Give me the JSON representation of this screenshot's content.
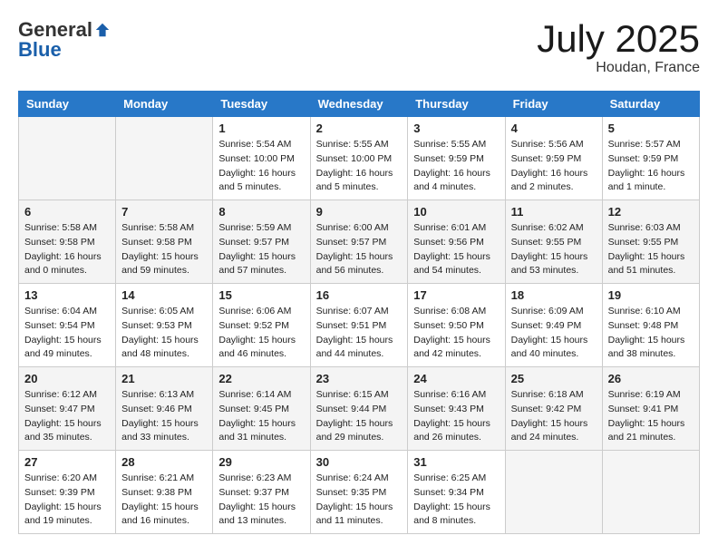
{
  "header": {
    "logo_general": "General",
    "logo_blue": "Blue",
    "month": "July 2025",
    "location": "Houdan, France"
  },
  "weekdays": [
    "Sunday",
    "Monday",
    "Tuesday",
    "Wednesday",
    "Thursday",
    "Friday",
    "Saturday"
  ],
  "weeks": [
    [
      {
        "day": "",
        "empty": true
      },
      {
        "day": "",
        "empty": true
      },
      {
        "day": "1",
        "sunrise": "5:54 AM",
        "sunset": "10:00 PM",
        "daylight": "16 hours and 5 minutes."
      },
      {
        "day": "2",
        "sunrise": "5:55 AM",
        "sunset": "10:00 PM",
        "daylight": "16 hours and 5 minutes."
      },
      {
        "day": "3",
        "sunrise": "5:55 AM",
        "sunset": "9:59 PM",
        "daylight": "16 hours and 4 minutes."
      },
      {
        "day": "4",
        "sunrise": "5:56 AM",
        "sunset": "9:59 PM",
        "daylight": "16 hours and 2 minutes."
      },
      {
        "day": "5",
        "sunrise": "5:57 AM",
        "sunset": "9:59 PM",
        "daylight": "16 hours and 1 minute."
      }
    ],
    [
      {
        "day": "6",
        "sunrise": "5:58 AM",
        "sunset": "9:58 PM",
        "daylight": "16 hours and 0 minutes."
      },
      {
        "day": "7",
        "sunrise": "5:58 AM",
        "sunset": "9:58 PM",
        "daylight": "15 hours and 59 minutes."
      },
      {
        "day": "8",
        "sunrise": "5:59 AM",
        "sunset": "9:57 PM",
        "daylight": "15 hours and 57 minutes."
      },
      {
        "day": "9",
        "sunrise": "6:00 AM",
        "sunset": "9:57 PM",
        "daylight": "15 hours and 56 minutes."
      },
      {
        "day": "10",
        "sunrise": "6:01 AM",
        "sunset": "9:56 PM",
        "daylight": "15 hours and 54 minutes."
      },
      {
        "day": "11",
        "sunrise": "6:02 AM",
        "sunset": "9:55 PM",
        "daylight": "15 hours and 53 minutes."
      },
      {
        "day": "12",
        "sunrise": "6:03 AM",
        "sunset": "9:55 PM",
        "daylight": "15 hours and 51 minutes."
      }
    ],
    [
      {
        "day": "13",
        "sunrise": "6:04 AM",
        "sunset": "9:54 PM",
        "daylight": "15 hours and 49 minutes."
      },
      {
        "day": "14",
        "sunrise": "6:05 AM",
        "sunset": "9:53 PM",
        "daylight": "15 hours and 48 minutes."
      },
      {
        "day": "15",
        "sunrise": "6:06 AM",
        "sunset": "9:52 PM",
        "daylight": "15 hours and 46 minutes."
      },
      {
        "day": "16",
        "sunrise": "6:07 AM",
        "sunset": "9:51 PM",
        "daylight": "15 hours and 44 minutes."
      },
      {
        "day": "17",
        "sunrise": "6:08 AM",
        "sunset": "9:50 PM",
        "daylight": "15 hours and 42 minutes."
      },
      {
        "day": "18",
        "sunrise": "6:09 AM",
        "sunset": "9:49 PM",
        "daylight": "15 hours and 40 minutes."
      },
      {
        "day": "19",
        "sunrise": "6:10 AM",
        "sunset": "9:48 PM",
        "daylight": "15 hours and 38 minutes."
      }
    ],
    [
      {
        "day": "20",
        "sunrise": "6:12 AM",
        "sunset": "9:47 PM",
        "daylight": "15 hours and 35 minutes."
      },
      {
        "day": "21",
        "sunrise": "6:13 AM",
        "sunset": "9:46 PM",
        "daylight": "15 hours and 33 minutes."
      },
      {
        "day": "22",
        "sunrise": "6:14 AM",
        "sunset": "9:45 PM",
        "daylight": "15 hours and 31 minutes."
      },
      {
        "day": "23",
        "sunrise": "6:15 AM",
        "sunset": "9:44 PM",
        "daylight": "15 hours and 29 minutes."
      },
      {
        "day": "24",
        "sunrise": "6:16 AM",
        "sunset": "9:43 PM",
        "daylight": "15 hours and 26 minutes."
      },
      {
        "day": "25",
        "sunrise": "6:18 AM",
        "sunset": "9:42 PM",
        "daylight": "15 hours and 24 minutes."
      },
      {
        "day": "26",
        "sunrise": "6:19 AM",
        "sunset": "9:41 PM",
        "daylight": "15 hours and 21 minutes."
      }
    ],
    [
      {
        "day": "27",
        "sunrise": "6:20 AM",
        "sunset": "9:39 PM",
        "daylight": "15 hours and 19 minutes."
      },
      {
        "day": "28",
        "sunrise": "6:21 AM",
        "sunset": "9:38 PM",
        "daylight": "15 hours and 16 minutes."
      },
      {
        "day": "29",
        "sunrise": "6:23 AM",
        "sunset": "9:37 PM",
        "daylight": "15 hours and 13 minutes."
      },
      {
        "day": "30",
        "sunrise": "6:24 AM",
        "sunset": "9:35 PM",
        "daylight": "15 hours and 11 minutes."
      },
      {
        "day": "31",
        "sunrise": "6:25 AM",
        "sunset": "9:34 PM",
        "daylight": "15 hours and 8 minutes."
      },
      {
        "day": "",
        "empty": true
      },
      {
        "day": "",
        "empty": true
      }
    ]
  ]
}
